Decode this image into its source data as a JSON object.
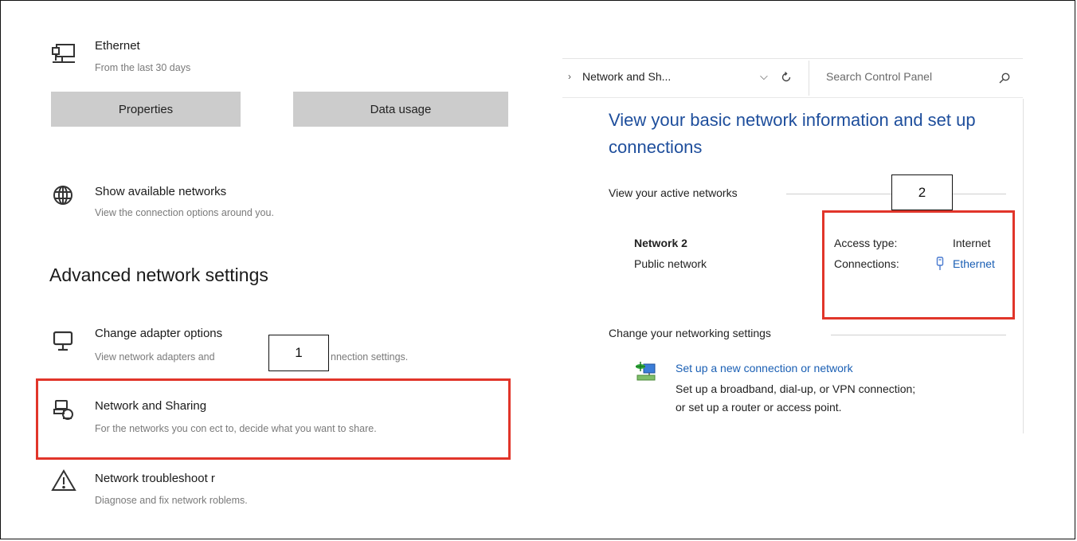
{
  "settings_panel": {
    "ethernet": {
      "icon": "ethernet-monitor-icon",
      "title": "Ethernet",
      "subtitle": "From the last 30 days"
    },
    "buttons": {
      "properties": "Properties",
      "data_usage": "Data usage"
    },
    "show_networks": {
      "icon": "globe-icon",
      "title": "Show available networks",
      "subtitle": "View the connection options around you."
    },
    "advanced_heading": "Advanced network settings",
    "change_adapter": {
      "icon": "monitor-icon",
      "title": "Change adapter options",
      "subtitle_left": "View network adapters and",
      "subtitle_right": "nnection settings."
    },
    "sharing_center": {
      "icon": "network-sharing-icon",
      "title": "Network and Sharing",
      "subtitle": "For the networks you con ect to, decide what you want to share."
    },
    "troubleshooter": {
      "icon": "warning-icon",
      "title": "Network troubleshoot r",
      "subtitle": "Diagnose and fix network roblems."
    }
  },
  "control_panel": {
    "breadcrumb": "Network and Sh...",
    "search_placeholder": "Search Control Panel",
    "title": "View your basic network information and set up connections",
    "active_networks_label": "View your active networks",
    "network_name": "Network  2",
    "network_type": "Public network",
    "access_type_label": "Access type:",
    "access_type_value": "Internet",
    "connections_label": "Connections:",
    "connections_value": "Ethernet",
    "change_settings_label": "Change your networking settings",
    "setup_link": "Set up a new connection or network",
    "setup_desc_line1": "Set up a broadband, dial-up, or VPN connection;",
    "setup_desc_line2": "or set up a router or access point."
  },
  "annotations": {
    "label_1": "1",
    "label_2": "2",
    "highlight_color": "#e1352a"
  }
}
